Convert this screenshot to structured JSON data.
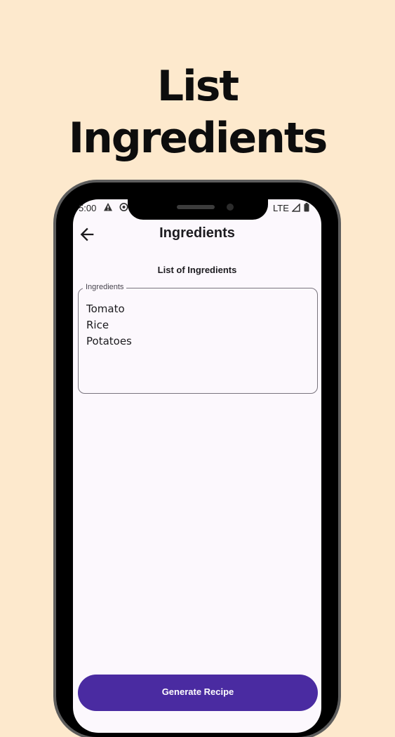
{
  "promo": {
    "title_line1": "List",
    "title_line2": "Ingredients"
  },
  "status_bar": {
    "time": "5:00",
    "network": "LTE",
    "icons": [
      "warning-icon",
      "app-notification-icon",
      "signal-icon",
      "battery-icon"
    ]
  },
  "app_bar": {
    "title": "Ingredients",
    "back_icon": "arrow-back-icon"
  },
  "content": {
    "section_heading": "List of Ingredients",
    "field": {
      "label": "Ingredients",
      "value": "Tomato\nRice\nPotatoes"
    }
  },
  "actions": {
    "generate_label": "Generate Recipe"
  },
  "colors": {
    "background": "#FDE9CD",
    "screen": "#FCF8FD",
    "primary_button": "#4A2BA1",
    "outline": "#79747E"
  }
}
